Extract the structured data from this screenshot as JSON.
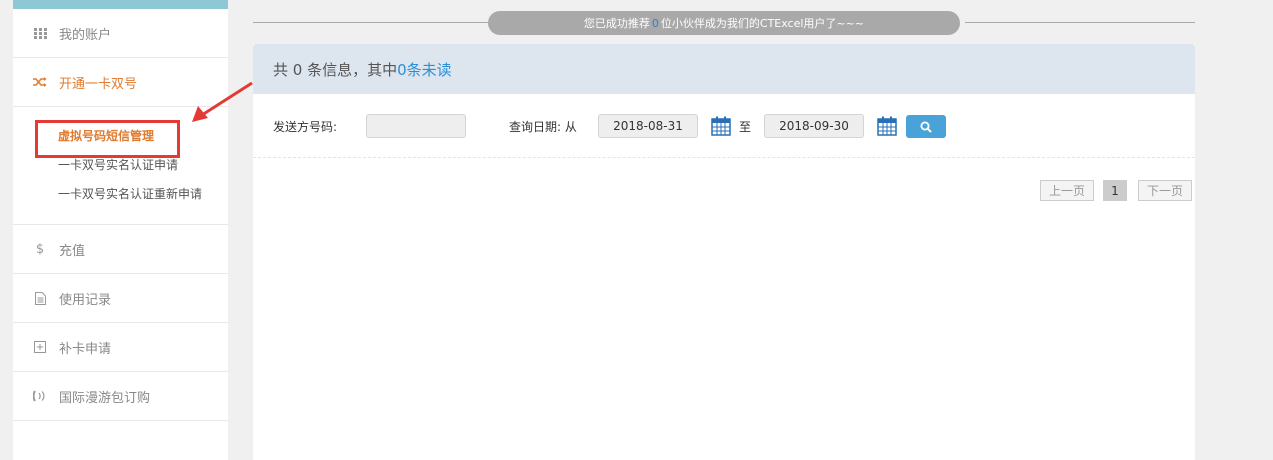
{
  "banner": {
    "prefix": "您已成功推荐",
    "count": "0",
    "suffix": "位小伙伴成为我们的CTExcel用户了~~~"
  },
  "sidebar": {
    "items": [
      {
        "label": "我的账户",
        "icon": "grid-icon"
      },
      {
        "label": "开通一卡双号",
        "icon": "shuffle-icon"
      },
      {
        "label": "充值",
        "icon": "dollar-icon"
      },
      {
        "label": "使用记录",
        "icon": "document-icon"
      },
      {
        "label": "补卡申请",
        "icon": "plus-square-icon"
      },
      {
        "label": "国际漫游包订购",
        "icon": "phone-signal-icon"
      }
    ],
    "subitems": [
      {
        "label": "虚拟号码短信管理"
      },
      {
        "label": "一卡双号实名认证申请"
      },
      {
        "label": "一卡双号实名认证重新申请"
      }
    ]
  },
  "panel": {
    "header_prefix": "共 0 条信息，其中",
    "header_unread": "0条未读"
  },
  "filter": {
    "sender_label": "发送方号码:",
    "sender_value": "",
    "date_label": "查询日期: 从",
    "date_from": "2018-08-31",
    "to_label": "至",
    "date_to": "2018-09-30"
  },
  "pagination": {
    "prev": "上一页",
    "current": "1",
    "next": "下一页"
  },
  "colors": {
    "accent": "#e07b2f",
    "link": "#2a8fd4",
    "highlight": "#e53935",
    "search_button": "#4aa3d8"
  }
}
